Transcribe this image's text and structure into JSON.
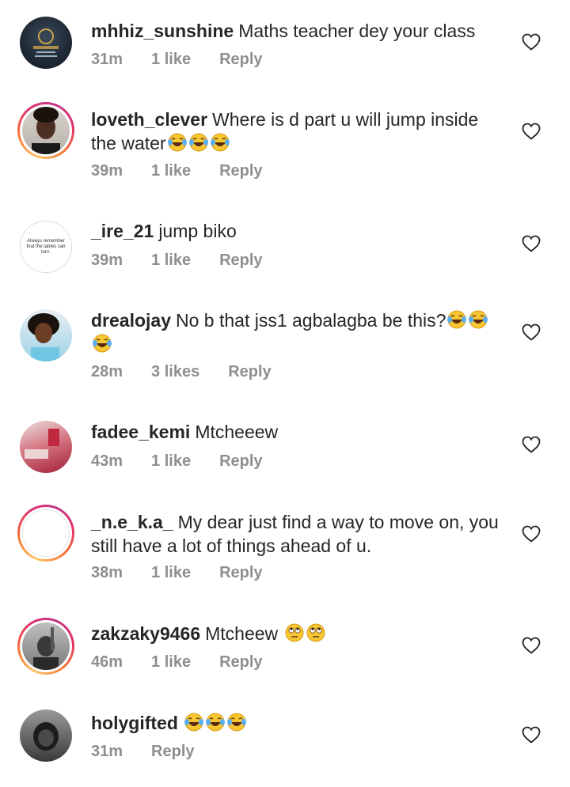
{
  "comments": [
    {
      "username": "mhhiz_sunshine",
      "text": "Maths teacher dey your class",
      "emojis": [],
      "time": "31m",
      "likes": "1 like",
      "reply": "Reply",
      "avatar_text": "Mide's Fashion World"
    },
    {
      "username": "loveth_clever",
      "text": "Where is d part u will jump inside the water",
      "emojis": [
        "laughing-tears",
        "laughing-tears",
        "laughing-tears"
      ],
      "time": "39m",
      "likes": "1 like",
      "reply": "Reply"
    },
    {
      "username": "_ire_21",
      "text": "jump biko",
      "emojis": [],
      "time": "39m",
      "likes": "1 like",
      "reply": "Reply",
      "avatar_text": "Always remember that the tables can turn."
    },
    {
      "username": "drealojay",
      "text": "No b that jss1 agbalagba be this?",
      "emojis": [
        "laughing-tears",
        "laughing-tears",
        "laughing-tears"
      ],
      "time": "28m",
      "likes": "3 likes",
      "reply": "Reply"
    },
    {
      "username": "fadee_kemi",
      "text": "Mtcheeew",
      "emojis": [],
      "time": "43m",
      "likes": "1 like",
      "reply": "Reply"
    },
    {
      "username": "_n.e_k.a_",
      "text": "My dear just find a way to move on, you still have a lot of things ahead of u.",
      "emojis": [],
      "time": "38m",
      "likes": "1 like",
      "reply": "Reply"
    },
    {
      "username": "zakzaky9466",
      "text": "Mtcheew",
      "emojis": [
        "rolling-eyes",
        "rolling-eyes"
      ],
      "time": "46m",
      "likes": "1 like",
      "reply": "Reply"
    },
    {
      "username": "holygifted",
      "text": "",
      "emojis": [
        "laughing-tears",
        "laughing-tears",
        "laughing-tears"
      ],
      "time": "31m",
      "likes": "",
      "reply": "Reply"
    }
  ],
  "colors": {
    "meta": "#8e8e8e",
    "text": "#262626",
    "ring_start": "#fdc468",
    "ring_end": "#c13584"
  }
}
